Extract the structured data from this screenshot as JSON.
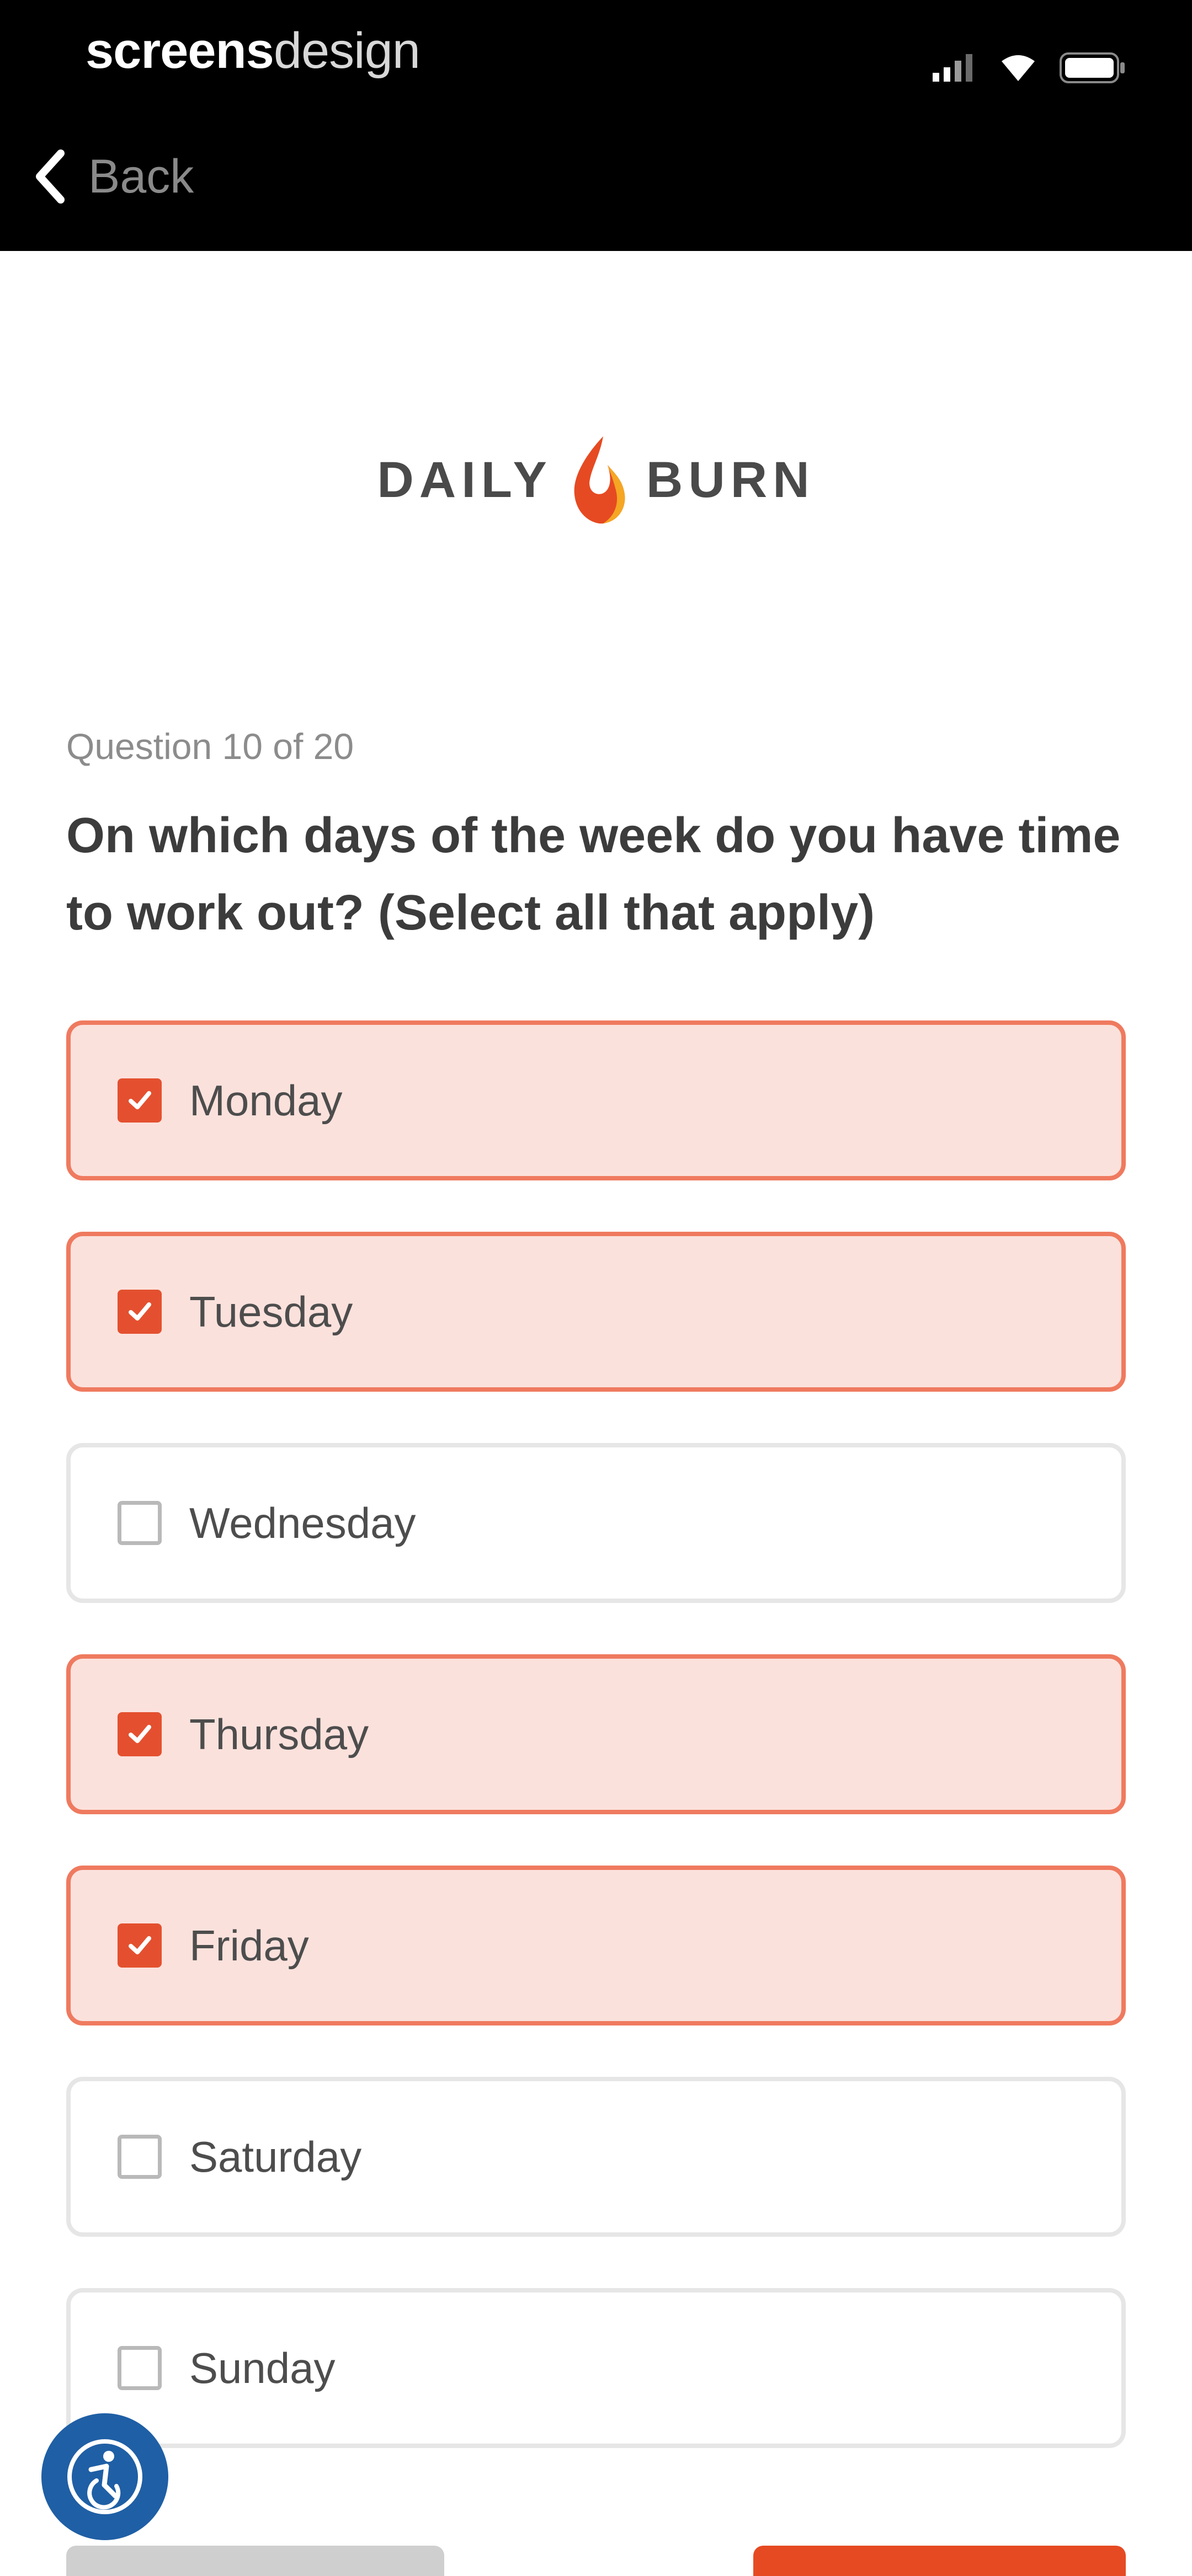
{
  "status_bar": {
    "brand_part1": "screens",
    "brand_part2": "design"
  },
  "nav": {
    "back_label": "Back"
  },
  "logo": {
    "left_word": "DAILY",
    "right_word": "BURN"
  },
  "question": {
    "counter": "Question 10 of 20",
    "text": "On which days of the week do you have time to work out? (Select all that apply)"
  },
  "options": [
    {
      "label": "Monday",
      "selected": true
    },
    {
      "label": "Tuesday",
      "selected": true
    },
    {
      "label": "Wednesday",
      "selected": false
    },
    {
      "label": "Thursday",
      "selected": true
    },
    {
      "label": "Friday",
      "selected": true
    },
    {
      "label": "Saturday",
      "selected": false
    },
    {
      "label": "Sunday",
      "selected": false
    }
  ],
  "colors": {
    "accent": "#e4502f",
    "selected_bg": "#fbe1dc",
    "selected_border": "#ef7a5f",
    "fab": "#1f5fa5"
  },
  "icons": {
    "back": "chevron-left-icon",
    "signal": "signal-icon",
    "wifi": "wifi-icon",
    "battery": "battery-icon",
    "logo_flame": "flame-icon",
    "fab": "accessibility-icon"
  }
}
